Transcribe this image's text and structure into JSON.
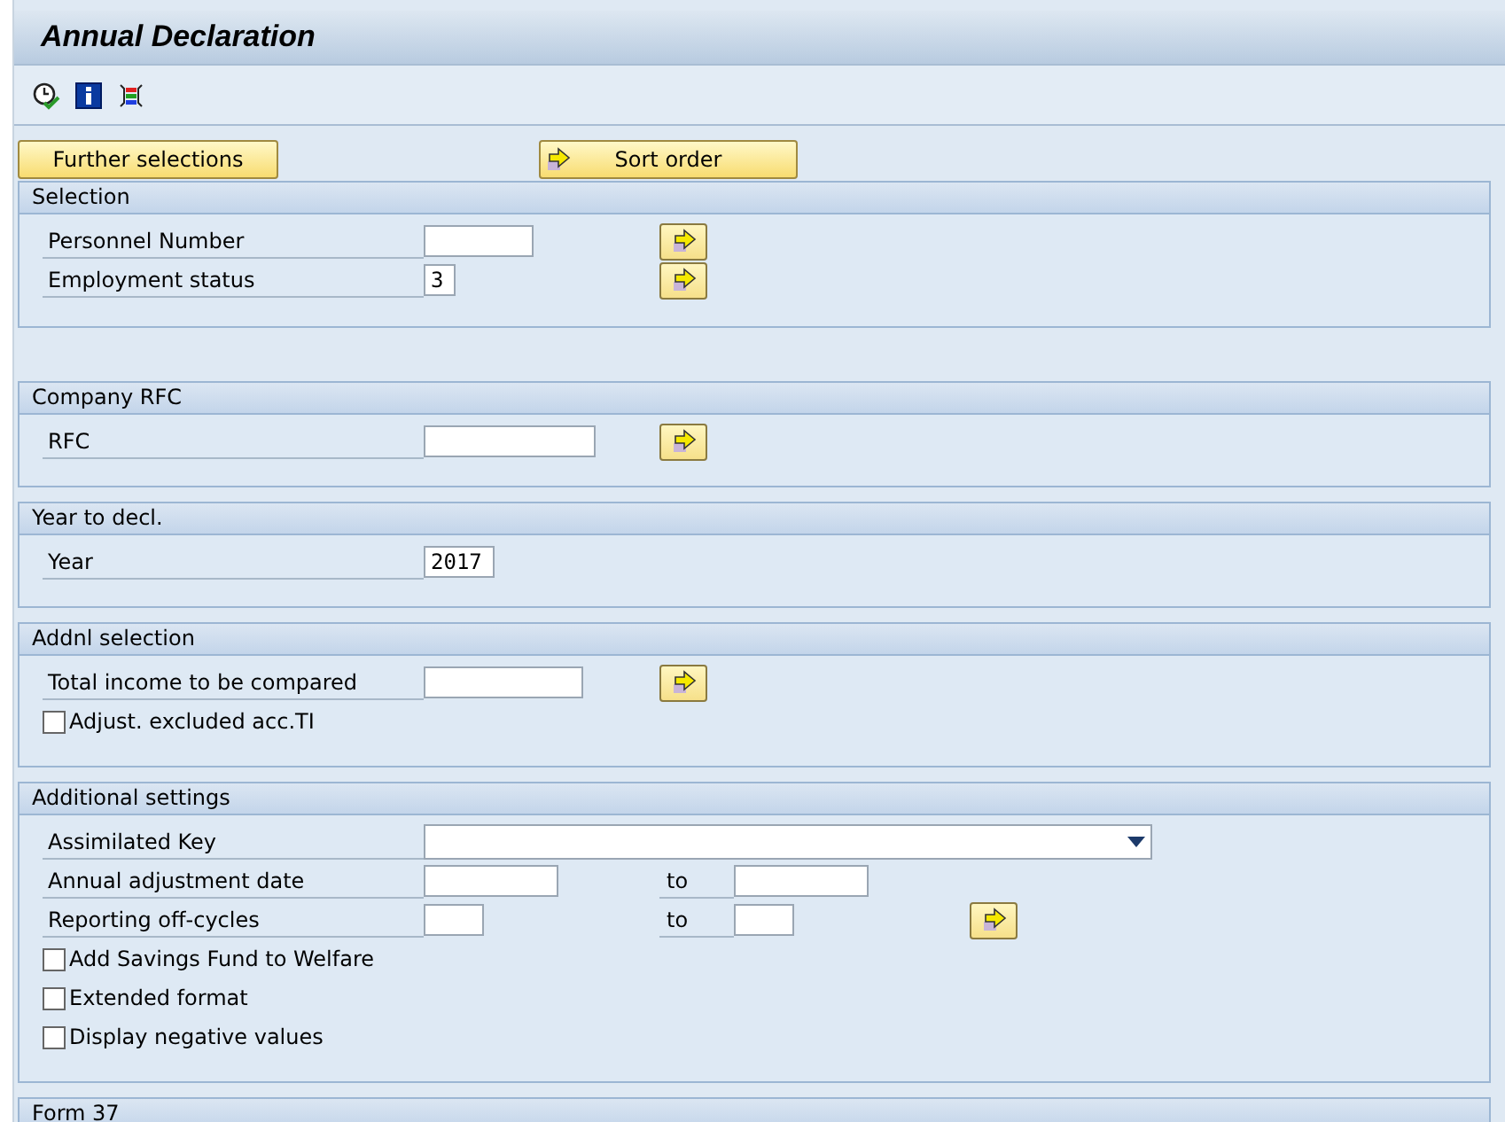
{
  "window": {
    "title": "Annual Declaration"
  },
  "toolbar": [
    {
      "kind": "execute"
    },
    {
      "kind": "info"
    },
    {
      "kind": "variants"
    }
  ],
  "top_buttons": [
    {
      "label": "Further selections",
      "arrow": false
    },
    {
      "label": "Sort order",
      "arrow": true
    }
  ],
  "sections": [
    {
      "title": "Selection",
      "rows": [
        {
          "kind": "field",
          "label": "Personnel Number",
          "value": "",
          "multi": true
        },
        {
          "kind": "field",
          "label": "Employment status",
          "value": "3",
          "multi": true
        }
      ]
    },
    {
      "title": "Company RFC",
      "rows": [
        {
          "kind": "field",
          "label": "RFC",
          "value": "",
          "multi": true
        }
      ]
    },
    {
      "title": "Year to decl.",
      "rows": [
        {
          "kind": "field",
          "label": "Year",
          "value": "2017",
          "multi": false
        }
      ]
    },
    {
      "title": "Addnl selection",
      "rows": [
        {
          "kind": "field",
          "label": "Total income to be compared",
          "value": "",
          "multi": true
        },
        {
          "kind": "checkbox",
          "label": "Adjust. excluded acc.TI",
          "checked": false
        }
      ]
    },
    {
      "title": "Additional settings",
      "rows": [
        {
          "kind": "dropdown",
          "label": "Assimilated Key",
          "value": ""
        },
        {
          "kind": "range",
          "label": "Annual adjustment date",
          "value": "",
          "to_label": "to",
          "to_value": "",
          "multi": false
        },
        {
          "kind": "range",
          "label": "Reporting off-cycles",
          "value": "",
          "to_label": "to",
          "to_value": "",
          "multi": true
        },
        {
          "kind": "checkbox",
          "label": "Add Savings Fund to Welfare",
          "checked": false
        },
        {
          "kind": "checkbox",
          "label": "Extended format",
          "checked": false
        },
        {
          "kind": "checkbox",
          "label": "Display negative values",
          "checked": false
        }
      ]
    },
    {
      "title": "Form 37"
    }
  ]
}
